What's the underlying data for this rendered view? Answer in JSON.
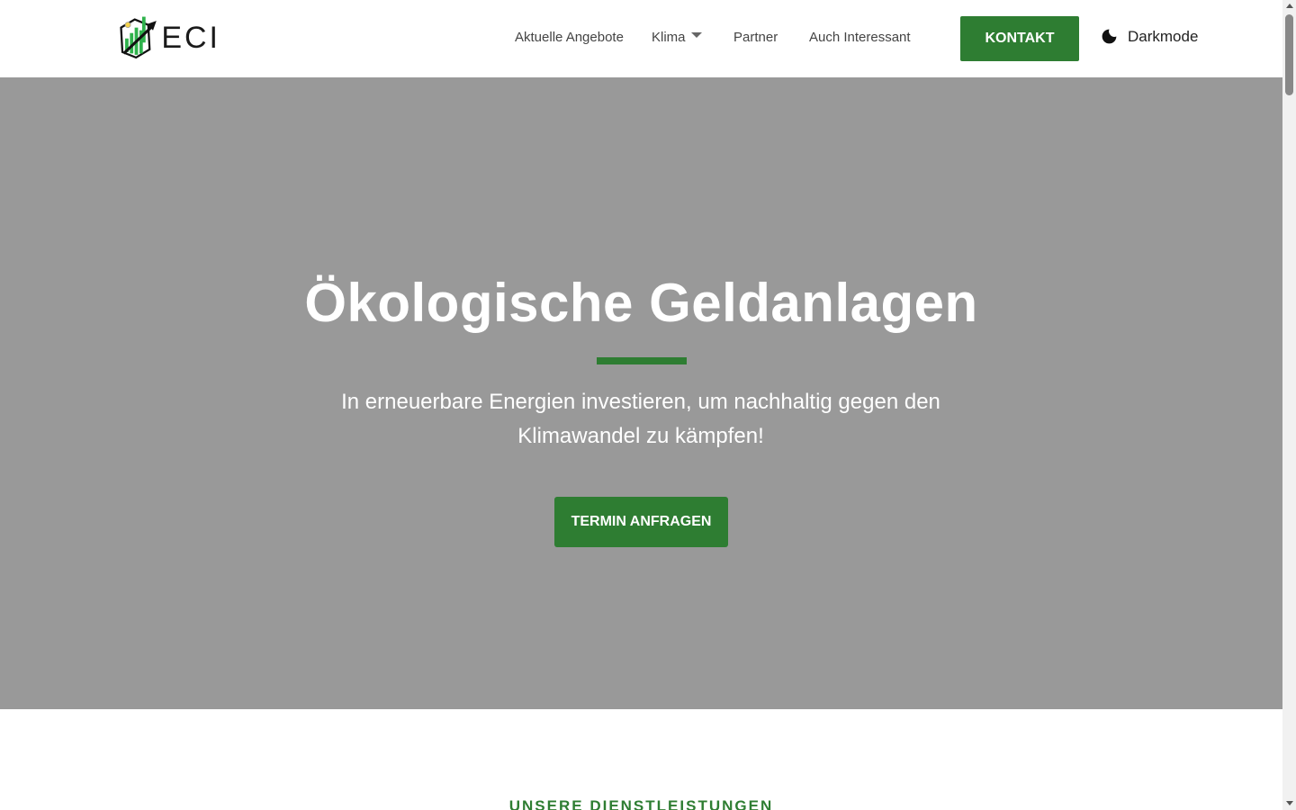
{
  "header": {
    "logo_text": "ECI",
    "nav": [
      {
        "label": "Aktuelle Angebote"
      },
      {
        "label": "Klima"
      },
      {
        "label": "Partner"
      },
      {
        "label": "Auch Interessant"
      }
    ],
    "contact_button": "KONTAKT",
    "darkmode_label": "Darkmode"
  },
  "hero": {
    "title": "Ökologische Geldanlagen",
    "subtitle": "In erneuerbare Energien investieren, um nachhaltig gegen den Klimawandel zu kämpfen!",
    "cta": "TERMIN ANFRAGEN"
  },
  "section": {
    "label": "UNSERE DIENSTLEISTUNGEN"
  },
  "colors": {
    "accent": "#2e7d32",
    "hero_bg": "#999999",
    "logo_green": "#2fb24c"
  },
  "icons": {
    "logo": "eci-logo-icon",
    "caret": "caret-down-icon",
    "darkmode": "moon-icon"
  }
}
